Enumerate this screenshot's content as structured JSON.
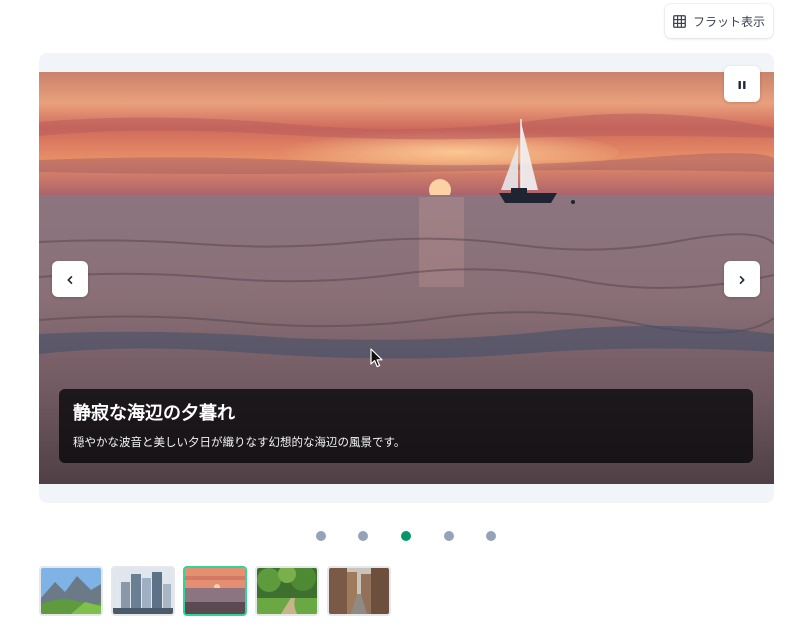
{
  "toolbar": {
    "flat_view_label": "フラット表示",
    "flat_view_icon": "grid-icon"
  },
  "slide": {
    "title": "静寂な海辺の夕暮れ",
    "description": "穏やかな波音と美しい夕日が織りなす幻想的な海辺の風景です。",
    "image": "sunset-sailboat-sea"
  },
  "controls": {
    "pause_icon": "pause-icon",
    "prev_icon": "chevron-left-icon",
    "next_icon": "chevron-right-icon"
  },
  "pagination": {
    "total": 5,
    "active_index": 2
  },
  "thumbnails": [
    {
      "image": "mountain-valley"
    },
    {
      "image": "city-skyscrapers"
    },
    {
      "image": "sunset-sea",
      "active": true
    },
    {
      "image": "green-park-path"
    },
    {
      "image": "old-town-street"
    }
  ],
  "colors": {
    "accent": "#059669",
    "dot_inactive": "#94a3b8",
    "thumb_active_border": "#34d399"
  }
}
